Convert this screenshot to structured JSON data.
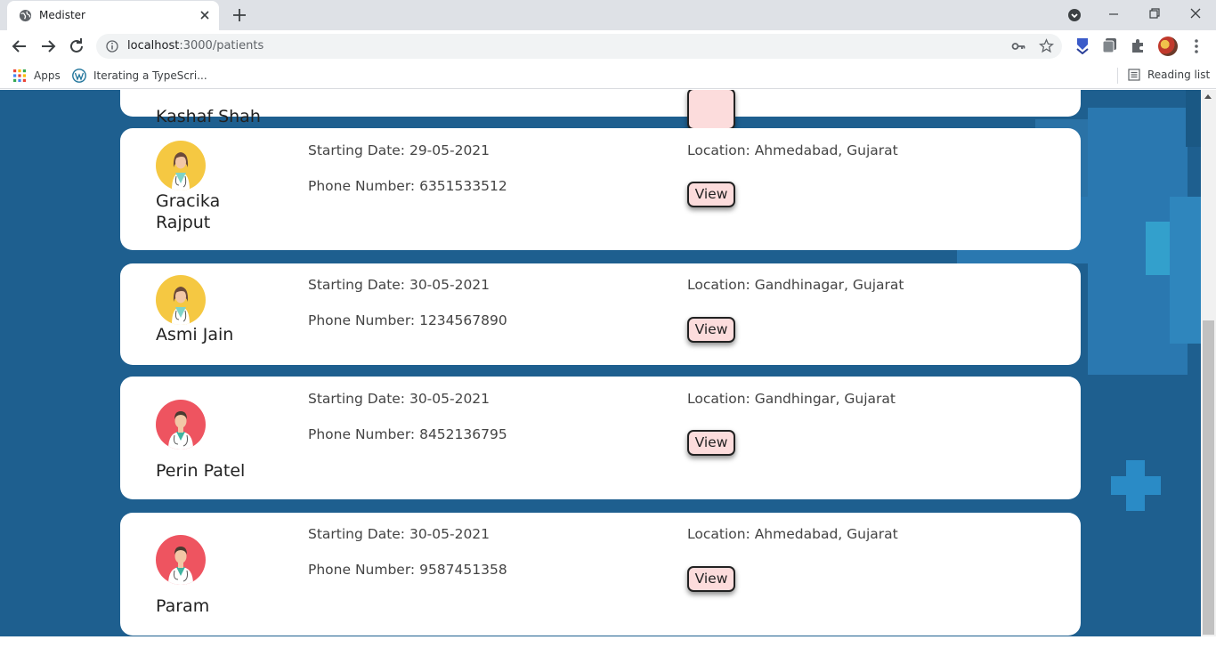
{
  "browser": {
    "tab_title": "Medister",
    "url_host": "localhost",
    "url_rest": ":3000/patients",
    "bookmarks": [
      {
        "label": "Apps",
        "icon": "apps-grid-icon"
      },
      {
        "label": "Iterating a TypeScri...",
        "icon": "wordpress-icon"
      }
    ],
    "reading_list": "Reading list"
  },
  "page": {
    "partial_card": {
      "name": "Kashaf Shah"
    },
    "patients": [
      {
        "name": "Gracika Rajput",
        "gender": "female",
        "starting_date": "Starting Date: 29-05-2021",
        "phone": "Phone Number: 6351533512",
        "location": "Location: Ahmedabad, Gujarat",
        "view_label": "View"
      },
      {
        "name": "Asmi Jain",
        "gender": "female",
        "starting_date": "Starting Date: 30-05-2021",
        "phone": "Phone Number: 1234567890",
        "location": "Location: Gandhinagar, Gujarat",
        "view_label": "View"
      },
      {
        "name": "Perin Patel",
        "gender": "male",
        "starting_date": "Starting Date: 30-05-2021",
        "phone": "Phone Number: 8452136795",
        "location": "Location: Gandhingar, Gujarat",
        "view_label": "View"
      },
      {
        "name": "Param",
        "gender": "male",
        "starting_date": "Starting Date: 30-05-2021",
        "phone": "Phone Number: 9587451358",
        "location": "Location: Ahmedabad, Gujarat",
        "view_label": "View"
      }
    ]
  },
  "colors": {
    "page_background": "#1e5f8f",
    "view_button": "#fcdcdc",
    "female_avatar": "#f5c842",
    "male_avatar": "#ee5460"
  }
}
